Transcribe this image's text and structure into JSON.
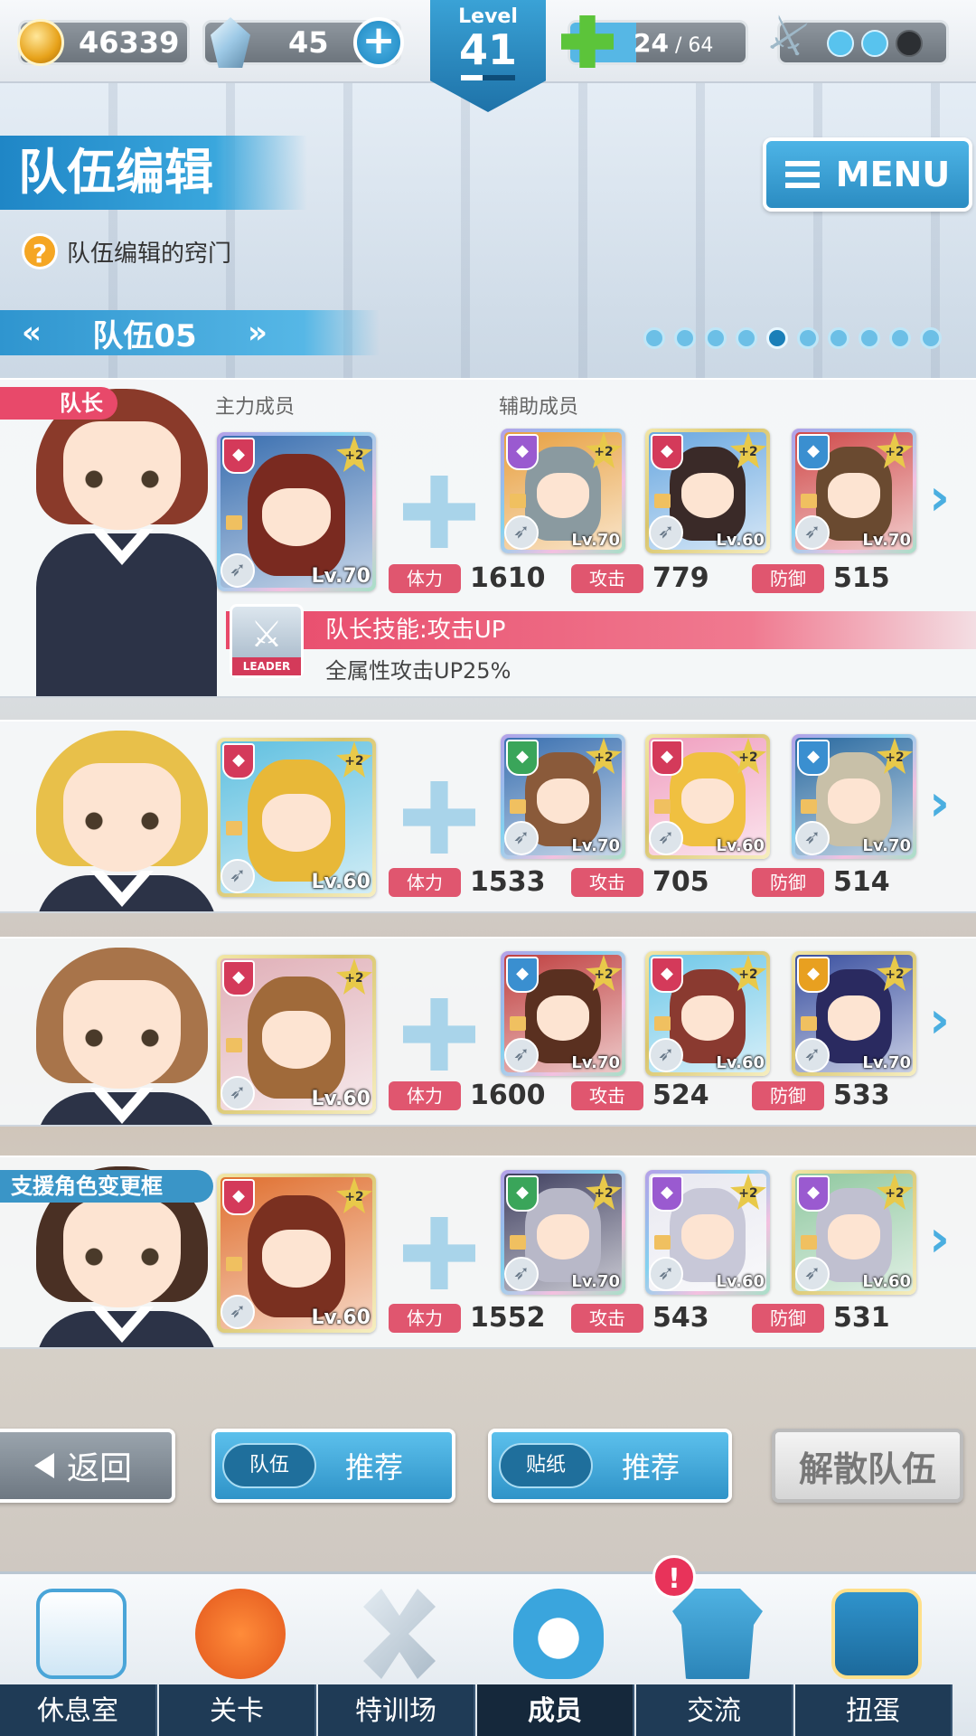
{
  "hud": {
    "coins": "46339",
    "gems": "45",
    "level_label": "Level",
    "level": "41",
    "stamina_current": "24",
    "stamina_sep_max": " / 64",
    "stamina_fraction": 0.375,
    "sword_charges": {
      "filled": 2,
      "total": 3
    }
  },
  "header": {
    "title": "队伍编辑",
    "tip": "队伍编辑的窍门",
    "menu_label": "MENU"
  },
  "team_nav": {
    "prev": "«",
    "name": "队伍05",
    "next": "»",
    "page_count": 10,
    "current_page_index": 4
  },
  "columns": {
    "main": "主力成员",
    "support": "辅助成员"
  },
  "leader_tag": "队长",
  "support_tag": "支援角色变更框",
  "leader_skill": {
    "badge": "LEADER",
    "name": "队长技能:攻击UP",
    "desc": "全属性攻击UP25%"
  },
  "stat_labels": {
    "hp": "体力",
    "atk": "攻击",
    "def": "防御"
  },
  "rows": [
    {
      "hair_color": "#8a3a2a",
      "main": {
        "lv": "Lv.70",
        "plus": "+2",
        "frame": "rb",
        "attr_color": "#d43a5a",
        "art": "#3a6fb0",
        "hair": "#7a2a20"
      },
      "supports": [
        {
          "lv": "Lv.70",
          "plus": "+2",
          "frame": "rb",
          "attr_color": "#9a5ad0",
          "art": "#e8a040",
          "hair": "#8a9aa0"
        },
        {
          "lv": "Lv.60",
          "plus": "+2",
          "frame": "gold",
          "attr_color": "#d43a5a",
          "art": "#6aa8e0",
          "hair": "#3a2a28"
        },
        {
          "lv": "Lv.70",
          "plus": "+2",
          "frame": "rb",
          "attr_color": "#3a8fd0",
          "art": "#d04a4a",
          "hair": "#6a4a30"
        }
      ],
      "hp": "1610",
      "atk": "779",
      "def": "515"
    },
    {
      "hair_color": "#e8c04a",
      "main": {
        "lv": "Lv.60",
        "plus": "+2",
        "frame": "gold",
        "attr_color": "#d43a5a",
        "art": "#60c0e0",
        "hair": "#e8b838"
      },
      "supports": [
        {
          "lv": "Lv.70",
          "plus": "+2",
          "frame": "rb",
          "attr_color": "#3aa55a",
          "art": "#3a70b0",
          "hair": "#8a5a3a"
        },
        {
          "lv": "Lv.60",
          "plus": "+2",
          "frame": "gold",
          "attr_color": "#d43a5a",
          "art": "#f0a0c0",
          "hair": "#f0c040"
        },
        {
          "lv": "Lv.70",
          "plus": "+2",
          "frame": "rb",
          "attr_color": "#3a8fd0",
          "art": "#2a6aa0",
          "hair": "#c8c0a8"
        }
      ],
      "hp": "1533",
      "atk": "705",
      "def": "514"
    },
    {
      "hair_color": "#a8744a",
      "main": {
        "lv": "Lv.60",
        "plus": "+2",
        "frame": "gold",
        "attr_color": "#d43a5a",
        "art": "#e0b0b8",
        "hair": "#a06a3a"
      },
      "supports": [
        {
          "lv": "Lv.70",
          "plus": "+2",
          "frame": "rb",
          "attr_color": "#3a8fd0",
          "art": "#c04040",
          "hair": "#5a3020"
        },
        {
          "lv": "Lv.60",
          "plus": "+2",
          "frame": "gold",
          "attr_color": "#d43a5a",
          "art": "#70c8e8",
          "hair": "#8a3a30"
        },
        {
          "lv": "Lv.70",
          "plus": "+2",
          "frame": "gold",
          "attr_color": "#e8a020",
          "art": "#3a50a0",
          "hair": "#2a2a60"
        }
      ],
      "hp": "1600",
      "atk": "524",
      "def": "533"
    },
    {
      "hair_color": "#4a3024",
      "main": {
        "lv": "Lv.60",
        "plus": "+2",
        "frame": "gold",
        "attr_color": "#d43a5a",
        "art": "#e07030",
        "hair": "#7a3020"
      },
      "supports": [
        {
          "lv": "Lv.70",
          "plus": "+2",
          "frame": "rb",
          "attr_color": "#3aa55a",
          "art": "#404060",
          "hair": "#b8b8c8"
        },
        {
          "lv": "Lv.60",
          "plus": "+2",
          "frame": "rb",
          "attr_color": "#9a5ad0",
          "art": "#e8e8f0",
          "hair": "#c8c8d8"
        },
        {
          "lv": "Lv.60",
          "plus": "+2",
          "frame": "gold",
          "attr_color": "#9a5ad0",
          "art": "#90c8a0",
          "hair": "#c0c0d0"
        }
      ],
      "hp": "1552",
      "atk": "543",
      "def": "531"
    }
  ],
  "actions": {
    "back": "返回",
    "team_sub": "队伍",
    "team_recommend": "推荐",
    "sticker_sub": "贴纸",
    "sticker_recommend": "推荐",
    "disband": "解散队伍"
  },
  "nav": {
    "items": [
      {
        "label": "休息室",
        "icon": "school-building-icon"
      },
      {
        "label": "关卡",
        "icon": "demon-mask-icon"
      },
      {
        "label": "特训场",
        "icon": "crossed-swords-icon"
      },
      {
        "label": "成员",
        "icon": "cat-hood-icon"
      },
      {
        "label": "交流",
        "icon": "uniform-dress-icon"
      },
      {
        "label": "扭蛋",
        "icon": "curtain-stage-icon"
      }
    ],
    "active_index": 3,
    "social_badge": "!"
  }
}
